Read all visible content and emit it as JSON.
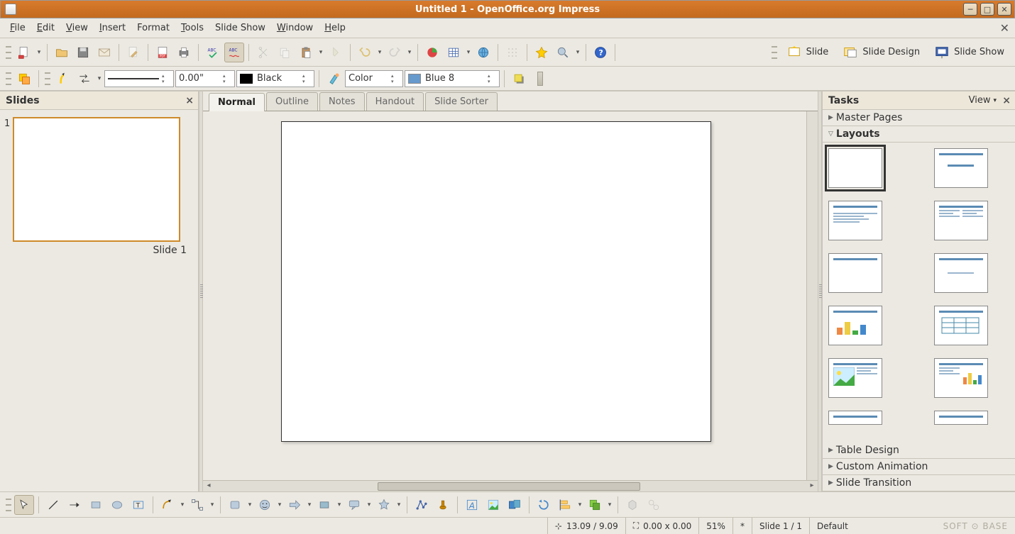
{
  "title": "Untitled 1 - OpenOffice.org Impress",
  "menu": [
    "File",
    "Edit",
    "View",
    "Insert",
    "Format",
    "Tools",
    "Slide Show",
    "Window",
    "Help"
  ],
  "rightButtons": {
    "slide": "Slide",
    "slideDesign": "Slide Design",
    "slideShow": "Slide Show"
  },
  "lineWidth": "0.00\"",
  "lineColorLabel": "Black",
  "fillMode": "Color",
  "fillColor": "Blue 8",
  "slidesPanel": {
    "title": "Slides",
    "slide1Label": "Slide 1",
    "slide1Num": "1"
  },
  "tabs": [
    "Normal",
    "Outline",
    "Notes",
    "Handout",
    "Slide Sorter"
  ],
  "tasksPanel": {
    "title": "Tasks",
    "viewLabel": "View",
    "sections": {
      "master": "Master Pages",
      "layouts": "Layouts",
      "tableDesign": "Table Design",
      "customAnimation": "Custom Animation",
      "slideTransition": "Slide Transition"
    }
  },
  "status": {
    "pos": "13.09 / 9.09",
    "size": "0.00 x 0.00",
    "zoom": "51%",
    "modified": "*",
    "slide": "Slide 1 / 1",
    "style": "Default"
  },
  "watermark": "SOFT ⊙ BASE"
}
